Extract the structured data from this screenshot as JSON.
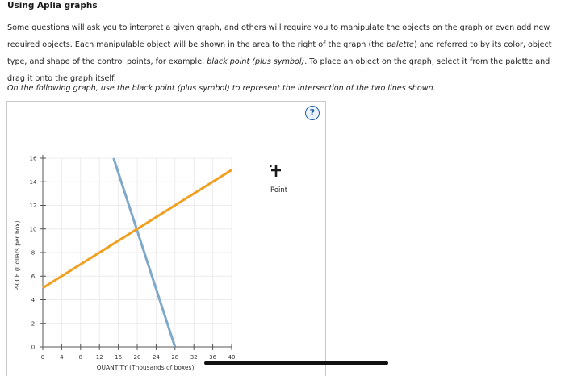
{
  "header": {
    "title": "Using Aplia graphs"
  },
  "intro": {
    "part1": "Some questions will ask you to interpret a given graph, and others will require you to manipulate the objects on the graph or even add new required objects. Each manipulable object will be shown in the area to the right of the graph (the ",
    "palette_word": "palette",
    "part2": ") and referred to by its color, object type, and shape of the control points, for example, ",
    "example": "black point (plus symbol)",
    "part3": ". To place an object on the graph, select it from the palette and drag it onto the graph itself."
  },
  "question": "On the following graph, use the black point (plus symbol) to represent the intersection of the two lines shown.",
  "help_icon": {
    "glyph": "?",
    "icon": "question-circle-icon"
  },
  "palette": {
    "items": [
      {
        "label": "Point",
        "icon": "black-plus-point-icon",
        "color": "#1a1a1a"
      }
    ]
  },
  "chart_data": {
    "type": "line",
    "xlabel": "QUANTITY (Thousands of boxes)",
    "ylabel": "PRICE (Dollars per box)",
    "xlim": [
      0,
      40
    ],
    "ylim": [
      0,
      16
    ],
    "x_ticks": [
      0,
      4,
      8,
      12,
      16,
      20,
      24,
      28,
      32,
      36,
      40
    ],
    "y_ticks": [
      0,
      2,
      4,
      6,
      8,
      10,
      12,
      14,
      16
    ],
    "grid": true,
    "series": [
      {
        "color": "#7fa8c9",
        "points": [
          [
            15,
            16
          ],
          [
            28,
            0
          ]
        ]
      },
      {
        "color": "#f0a020",
        "points": [
          [
            0,
            5
          ],
          [
            40,
            15
          ]
        ]
      }
    ]
  }
}
